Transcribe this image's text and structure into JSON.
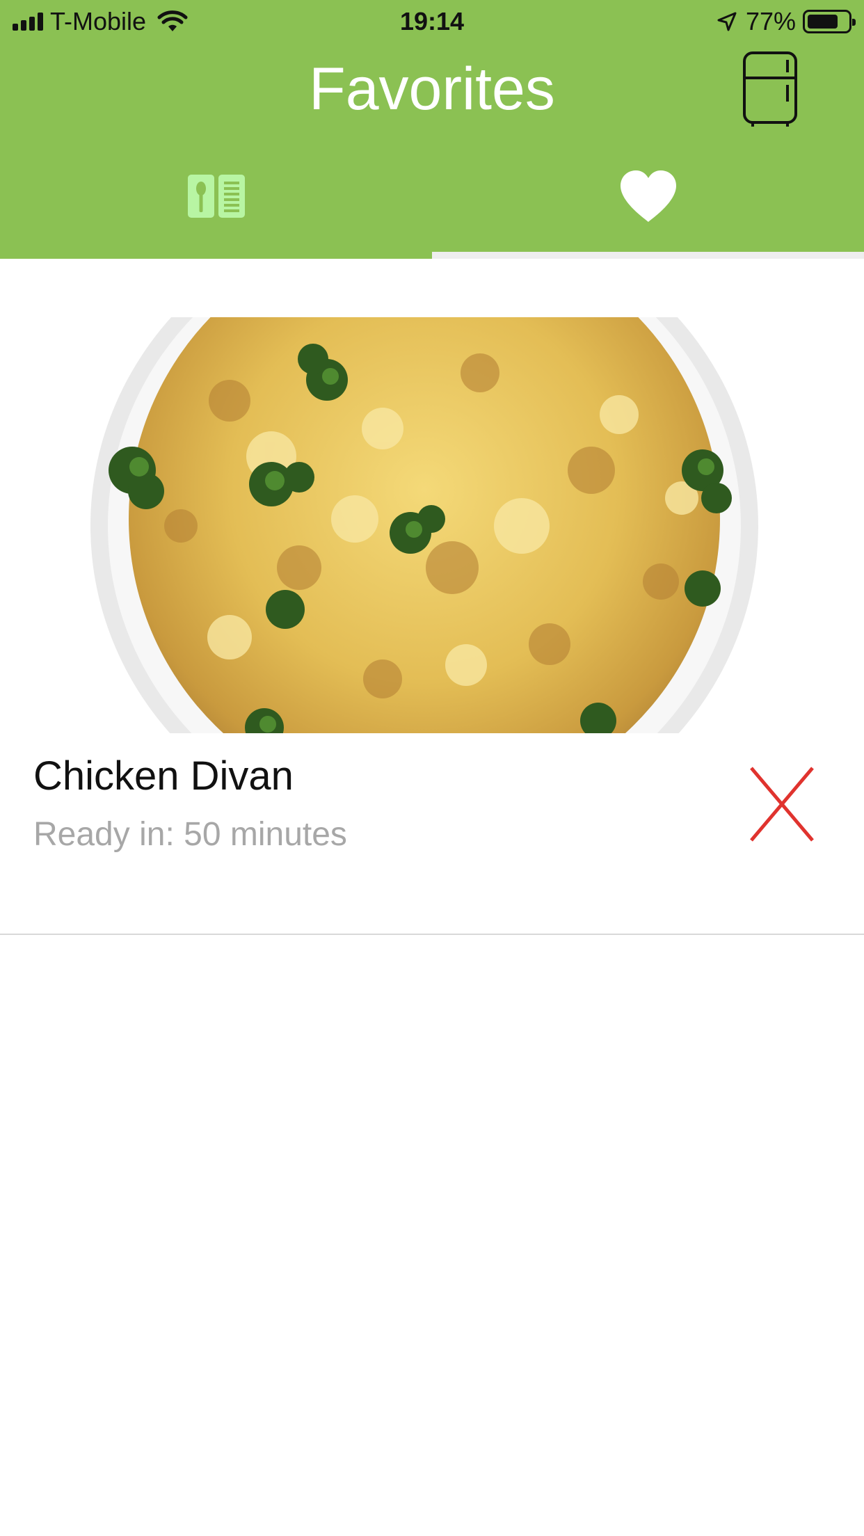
{
  "status_bar": {
    "carrier": "T-Mobile",
    "time": "19:14",
    "battery": "77%",
    "battery_level": 0.77
  },
  "nav": {
    "title": "Favorites",
    "right_icon": "fridge-icon"
  },
  "tabs": [
    {
      "icon": "recipe-book-icon",
      "selected": false
    },
    {
      "icon": "heart-icon",
      "selected": true
    }
  ],
  "favorites": [
    {
      "image": "casserole-photo",
      "title": "Chicken Divan",
      "ready_in": "Ready in: 50 minutes",
      "remove_icon": "close-icon"
    }
  ],
  "colors": {
    "header": "#8bc153",
    "tab_active": "#ffffff",
    "tab_inactive": "#b8f5a3",
    "remove": "#e0332e",
    "secondary_text": "#a7a7a7"
  }
}
